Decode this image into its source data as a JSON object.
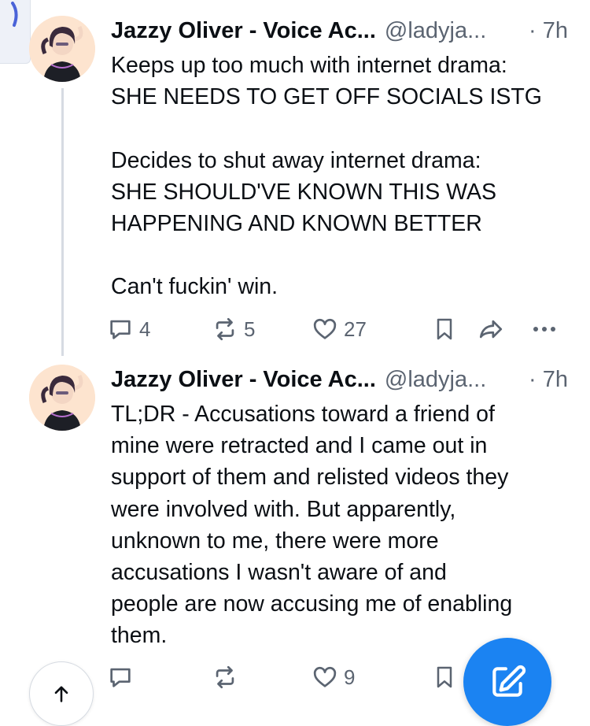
{
  "posts": [
    {
      "author": "Jazzy Oliver - Voice Ac...",
      "handle": "@ladyja...",
      "time": "· 7h",
      "text": "Keeps up too much with internet drama:\nSHE NEEDS TO GET OFF SOCIALS ISTG\n\nDecides to shut away internet drama:\nSHE SHOULD'VE KNOWN THIS WAS\nHAPPENING AND KNOWN BETTER\n\nCan't fuckin' win.",
      "replies": "4",
      "reposts": "5",
      "likes": "27"
    },
    {
      "author": "Jazzy Oliver - Voice Ac...",
      "handle": "@ladyja...",
      "time": "· 7h",
      "text": "TL;DR - Accusations toward a friend of\nmine were retracted and I came out in\nsupport of them and relisted videos they\nwere involved with. But apparently,\nunknown to me, there were more\naccusations I wasn't aware of and\npeople are now accusing me of enabling\nthem.",
      "likes": "9"
    }
  ],
  "icons": {
    "reply": "comment-bubble-icon",
    "repost": "repost-arrows-icon",
    "like": "heart-icon",
    "bookmark": "bookmark-icon",
    "share": "share-arrow-icon",
    "more": "ellipsis-icon",
    "scroll_top": "arrow-up-icon",
    "compose": "pencil-square-icon"
  },
  "colors": {
    "text": "#0b0f14",
    "muted": "#5b6471",
    "accent": "#1b83f2",
    "thread_line": "#d6dbe2"
  }
}
